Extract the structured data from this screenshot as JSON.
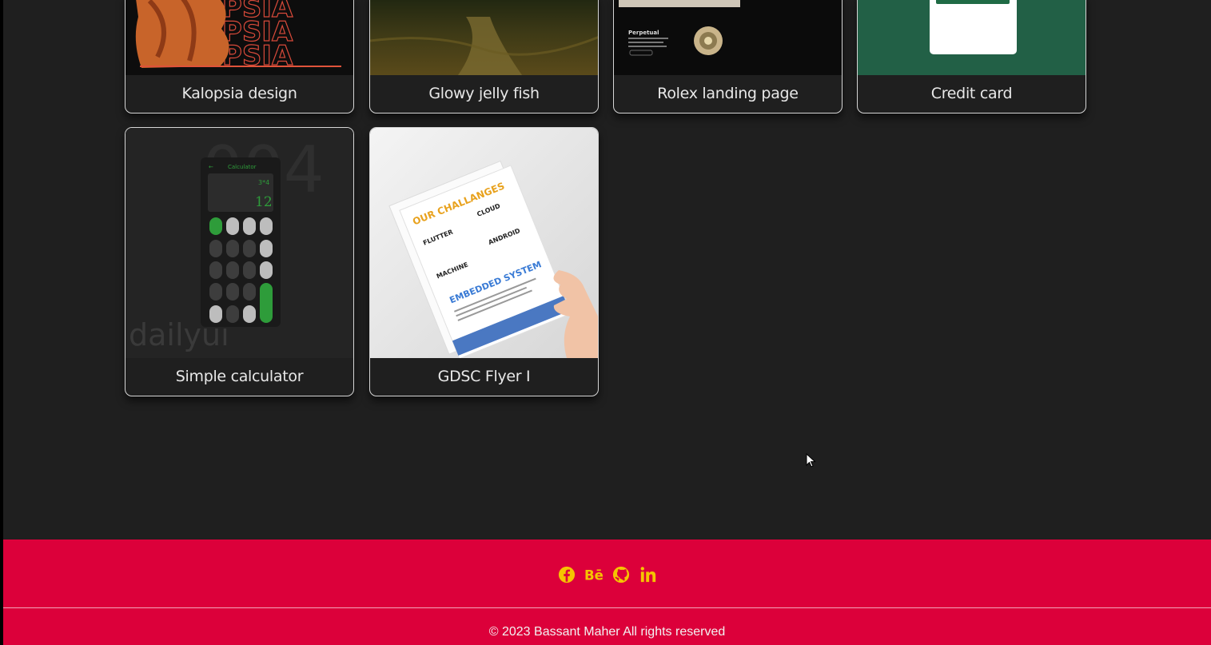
{
  "projects": [
    {
      "title": "Kalopsia design",
      "thumb_text": "KALOPSIA"
    },
    {
      "title": "Glowy jelly fish"
    },
    {
      "title": "Rolex landing page",
      "thumb_heading": "Perpetual"
    },
    {
      "title": "Credit card"
    },
    {
      "title": "Simple calculator",
      "thumb": {
        "app_title": "Calculator",
        "expression": "3*4",
        "result": "12",
        "watermark_number": "004",
        "watermark_text": "dailyui"
      }
    },
    {
      "title": "GDSC Flyer I",
      "thumb": {
        "heading": "OUR CHALLANGES",
        "items": [
          "FLUTTER",
          "CLOUD",
          "MACHINE",
          "ANDROID"
        ],
        "subheading": "EMBEDDED SYSTEM"
      }
    }
  ],
  "footer": {
    "social_icons": [
      "facebook-icon",
      "behance-icon",
      "github-icon",
      "linkedin-icon"
    ],
    "copyright": "© 2023 Bassant Maher All rights reserved"
  },
  "colors": {
    "page_bg": "#1f1f1f",
    "footer_bg": "#dc003a",
    "icon_color": "#f5c400",
    "calc_accent": "#2e9c3a"
  }
}
